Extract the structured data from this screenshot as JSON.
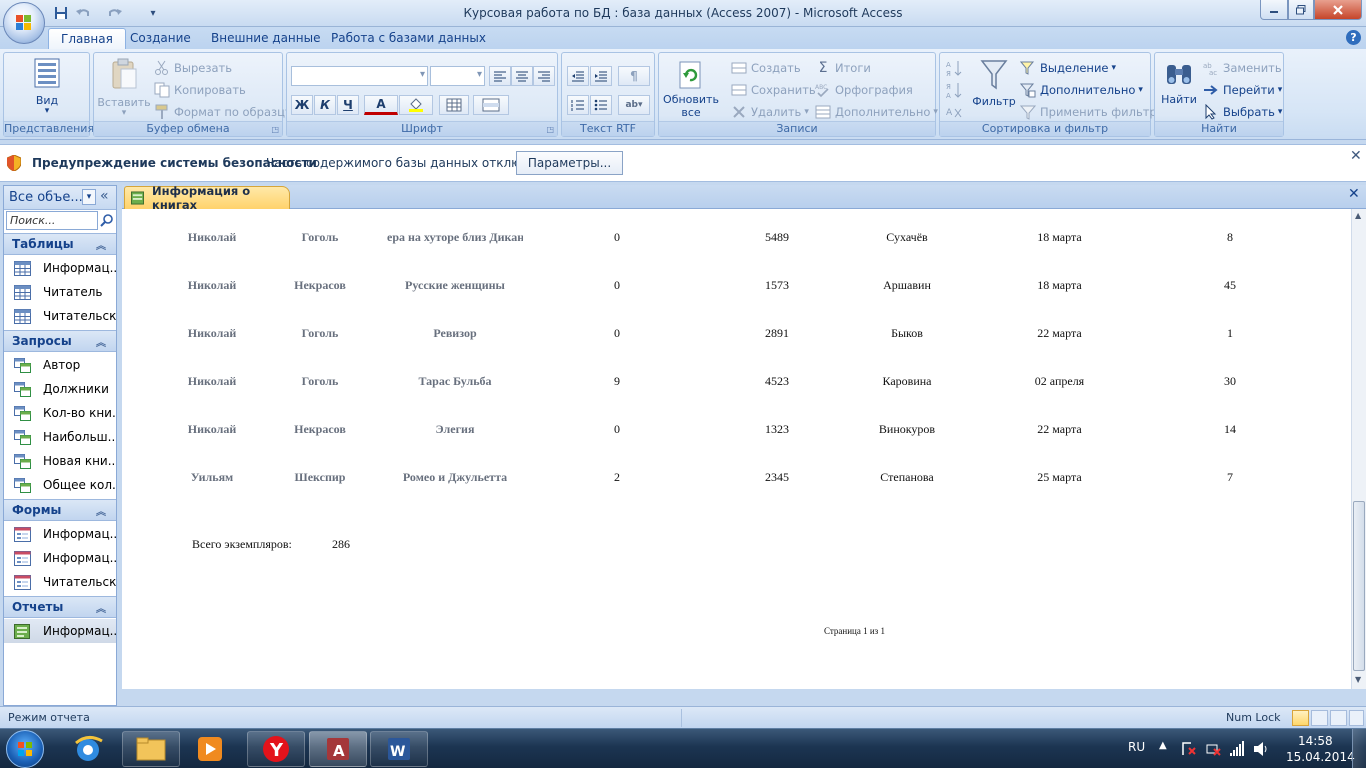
{
  "window": {
    "title": "Курсовая работа по БД : база данных (Access 2007) - Microsoft Access"
  },
  "tabs": [
    {
      "label": "Главная",
      "active": true
    },
    {
      "label": "Создание"
    },
    {
      "label": "Внешние данные"
    },
    {
      "label": "Работа с базами данных"
    }
  ],
  "ribbon": {
    "views": {
      "label": "Представления",
      "view_btn": "Вид"
    },
    "clipboard": {
      "label": "Буфер обмена",
      "paste": "Вставить",
      "cut": "Вырезать",
      "copy": "Копировать",
      "format_painter": "Формат по образцу"
    },
    "font": {
      "label": "Шрифт",
      "bold": "Ж",
      "italic": "К",
      "underline": "Ч",
      "font_color": "A"
    },
    "rtf": {
      "label": "Текст RTF"
    },
    "records": {
      "label": "Записи",
      "refresh": "Обновить",
      "refresh2": "все",
      "new": "Создать",
      "save": "Сохранить",
      "delete": "Удалить",
      "totals": "Итоги",
      "spelling": "Орфография",
      "more": "Дополнительно"
    },
    "sort": {
      "label": "Сортировка и фильтр",
      "filter": "Фильтр",
      "selection": "Выделение",
      "advanced": "Дополнительно",
      "toggle": "Применить фильтр"
    },
    "find": {
      "label": "Найти",
      "find_btn": "Найти",
      "replace": "Заменить",
      "goto": "Перейти",
      "select": "Выбрать"
    }
  },
  "security": {
    "title": "Предупреждение системы безопасности",
    "message": "Часть содержимого базы данных отключено",
    "button": "Параметры..."
  },
  "nav": {
    "header": "Все объе...",
    "search_placeholder": "Поиск...",
    "groups": [
      {
        "title": "Таблицы",
        "type": "table",
        "items": [
          "Информац...",
          "Читатель",
          "Читательск..."
        ]
      },
      {
        "title": "Запросы",
        "type": "query",
        "items": [
          "Автор",
          "Должники",
          "Кол-во кни...",
          "Наибольш...",
          "Новая кни...",
          "Общее кол..."
        ]
      },
      {
        "title": "Формы",
        "type": "form",
        "items": [
          "Информац...",
          "Информац...",
          "Читательск..."
        ]
      },
      {
        "title": "Отчеты",
        "type": "report",
        "items": [
          "Информац..."
        ]
      }
    ]
  },
  "document": {
    "tab_label": "Информация о книгах",
    "rows": [
      [
        "Николай",
        "Гоголь",
        "ера на хуторе близ Дикан",
        "0",
        "5489",
        "Сухачёв",
        "18 марта",
        "8"
      ],
      [
        "Николай",
        "Некрасов",
        "Русские женщины",
        "0",
        "1573",
        "Аршавин",
        "18 марта",
        "45"
      ],
      [
        "Николай",
        "Гоголь",
        "Ревизор",
        "0",
        "2891",
        "Быков",
        "22 марта",
        "1"
      ],
      [
        "Николай",
        "Гоголь",
        "Тарас Бульба",
        "9",
        "4523",
        "Каровина",
        "02 апреля",
        "30"
      ],
      [
        "Николай",
        "Некрасов",
        "Элегия",
        "0",
        "1323",
        "Винокуров",
        "22 марта",
        "14"
      ],
      [
        "Уильям",
        "Шекспир",
        "Ромео и Джульетта",
        "2",
        "2345",
        "Степанова",
        "25 марта",
        "7"
      ]
    ],
    "total_label": "Всего экземпляров:",
    "total_value": "286",
    "page_footer": "Страница 1 из 1"
  },
  "status": {
    "mode": "Режим отчета",
    "numlock": "Num Lock"
  },
  "taskbar": {
    "lang": "RU",
    "time": "14:58",
    "date": "15.04.2014"
  }
}
